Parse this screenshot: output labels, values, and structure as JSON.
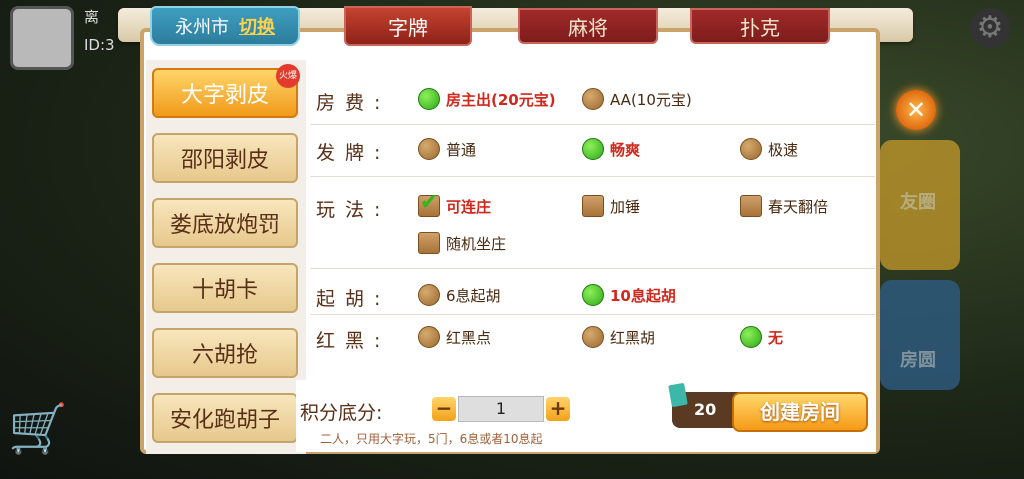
{
  "profile": {
    "name_partial": "离",
    "id_partial": "ID:3"
  },
  "city": {
    "name": "永州市",
    "switch_label": "切换"
  },
  "category_tabs": [
    {
      "label": "字牌",
      "active": true
    },
    {
      "label": "麻将",
      "active": false
    },
    {
      "label": "扑克",
      "active": false
    }
  ],
  "close_label": "✕",
  "games": [
    {
      "label": "大字剥皮",
      "active": true,
      "badge": "火爆"
    },
    {
      "label": "邵阳剥皮",
      "active": false
    },
    {
      "label": "娄底放炮罚",
      "active": false
    },
    {
      "label": "十胡卡",
      "active": false
    },
    {
      "label": "六胡抢",
      "active": false
    },
    {
      "label": "安化跑胡子",
      "active": false
    }
  ],
  "options": {
    "room_fee": {
      "label": "房费",
      "items": [
        {
          "text": "房主出(20元宝)",
          "selected": true
        },
        {
          "text": "AA(10元宝)",
          "selected": false
        }
      ]
    },
    "deal": {
      "label": "发牌",
      "items": [
        {
          "text": "普通",
          "selected": false
        },
        {
          "text": "畅爽",
          "selected": true
        },
        {
          "text": "极速",
          "selected": false
        }
      ]
    },
    "play": {
      "label": "玩法",
      "items": [
        {
          "text": "可连庄",
          "selected": true
        },
        {
          "text": "加锤",
          "selected": false
        },
        {
          "text": "春天翻倍",
          "selected": false
        },
        {
          "text": "随机坐庄",
          "selected": false
        }
      ]
    },
    "start_hu": {
      "label": "起胡",
      "items": [
        {
          "text": "6息起胡",
          "selected": false
        },
        {
          "text": "10息起胡",
          "selected": true
        }
      ]
    },
    "red_black": {
      "label": "红黑",
      "items": [
        {
          "text": "红黑点",
          "selected": false
        },
        {
          "text": "红黑胡",
          "selected": false
        },
        {
          "text": "无",
          "selected": true
        }
      ]
    }
  },
  "score": {
    "label": "积分底分:",
    "value": "1",
    "minus": "−",
    "plus": "+"
  },
  "hint": "二人，只用大字玩，5门，6息或者10息起",
  "cost": "20",
  "create_label": "创建房间",
  "side_labels": {
    "card1": "友圈",
    "card2": "房圆"
  }
}
